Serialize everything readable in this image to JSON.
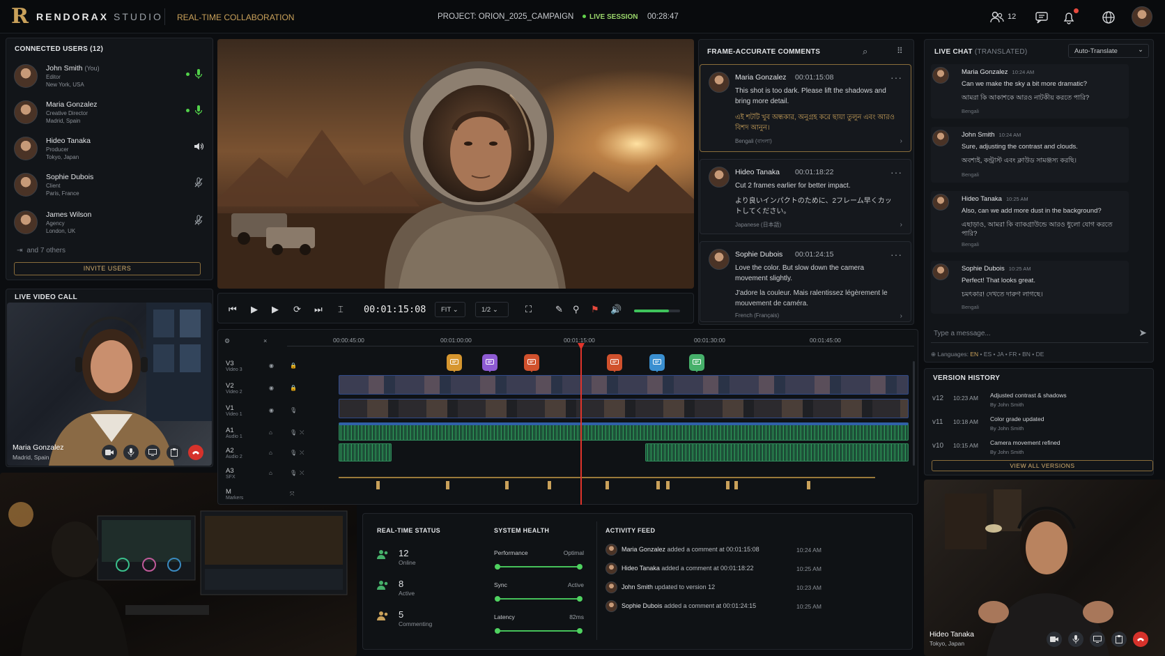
{
  "app": {
    "brand_name": "RENDORAX",
    "brand_sub": "STUDIO",
    "module_title": "REAL-TIME COLLABORATION",
    "project": "PROJECT: ORION_2025_CAMPAIGN",
    "live_label": "LIVE SESSION",
    "session_timer": "00:28:47",
    "user_count": "12"
  },
  "colors": {
    "accent_gold": "#c9a15a",
    "live_green": "#63d44c",
    "danger_red": "#d6322b",
    "audio_green": "#2f9b5a",
    "video_blue": "#2f4a8a"
  },
  "users": {
    "header": "CONNECTED USERS (12)",
    "list": [
      {
        "name": "John Smith",
        "you": "(You)",
        "role": "Editor",
        "location": "New York, USA",
        "status": "mic-on"
      },
      {
        "name": "Maria Gonzalez",
        "role": "Creative Director",
        "location": "Madrid, Spain",
        "status": "mic-on"
      },
      {
        "name": "Hideo Tanaka",
        "role": "Producer",
        "location": "Tokyo, Japan",
        "status": "speaker"
      },
      {
        "name": "Sophie Dubois",
        "role": "Client",
        "location": "Paris, France",
        "status": "muted"
      },
      {
        "name": "James Wilson",
        "role": "Agency",
        "location": "London, UK",
        "status": "muted"
      }
    ],
    "others": "and 7 others",
    "invite_label": "INVITE USERS"
  },
  "video_call": {
    "header": "LIVE VIDEO CALL",
    "caller_name": "Maria Gonzalez",
    "caller_location": "Madrid, Spain"
  },
  "second_call": {
    "name": "Hideo Tanaka",
    "location": "Tokyo, Japan"
  },
  "player": {
    "timecode": "00:01:15:08",
    "fit_label": "FIT",
    "res_label": "1/2",
    "volume": 0.75
  },
  "comments": {
    "header": "FRAME-ACCURATE COMMENTS",
    "items": [
      {
        "name": "Maria Gonzalez",
        "time": "00:01:15:08",
        "text": "This shot is too dark. Please lift the shadows and bring more detail.",
        "translation": "এই শটটি খুব অন্ধকার, অনুগ্রহ করে ছায়া তুলুন এবং আরও বিশদ আনুন।",
        "lang": "Bengali (বাংলা)"
      },
      {
        "name": "Hideo Tanaka",
        "time": "00:01:18:22",
        "text": "Cut 2 frames earlier for better impact.",
        "translation": "より良いインパクトのために、2フレーム早くカットしてください。",
        "lang": "Japanese (日本語)"
      },
      {
        "name": "Sophie Dubois",
        "time": "00:01:24:15",
        "text": "Love the color. But slow down the camera movement slightly.",
        "translation": "J'adore la couleur. Mais ralentissez légèrement le mouvement de caméra.",
        "lang": "French (Français)"
      }
    ]
  },
  "chat": {
    "header": "LIVE CHAT",
    "header_sub": "(TRANSLATED)",
    "translate_option": "Auto-Translate",
    "messages": [
      {
        "name": "Maria Gonzalez",
        "time": "10:24 AM",
        "text": "Can we make the sky a bit more dramatic?",
        "translation": "আমরা কি আকাশকে আরও নাটকীয় করতে পারি?",
        "lang": "Bengali"
      },
      {
        "name": "John Smith",
        "time": "10:24 AM",
        "text": "Sure, adjusting the contrast and clouds.",
        "translation": "অবশ্যই, কন্ট্রাস্ট এবং ক্লাউড সামঞ্জস্য করছি।",
        "lang": "Bengali"
      },
      {
        "name": "Hideo Tanaka",
        "time": "10:25 AM",
        "text": "Also, can we add more dust in the background?",
        "translation": "এছাড়াও, আমরা কি ব্যাকগ্রাউন্ডে আরও ধুলো যোগ করতে পারি?",
        "lang": "Bengali"
      },
      {
        "name": "Sophie Dubois",
        "time": "10:25 AM",
        "text": "Perfect! That looks great.",
        "translation": "চমৎকার! দেখতে দারুণ লাগছে।",
        "lang": "Bengali"
      }
    ],
    "input_placeholder": "Type a message...",
    "languages_label": "Languages:",
    "languages": [
      "EN",
      "ES",
      "JA",
      "FR",
      "BN",
      "DE"
    ]
  },
  "versions": {
    "header": "VERSION HISTORY",
    "items": [
      {
        "v": "v12",
        "time": "10:23 AM",
        "desc": "Adjusted contrast & shadows",
        "by": "By John Smith"
      },
      {
        "v": "v11",
        "time": "10:18 AM",
        "desc": "Color grade updated",
        "by": "By John Smith"
      },
      {
        "v": "v10",
        "time": "10:15 AM",
        "desc": "Camera movement refined",
        "by": "By John Smith"
      }
    ],
    "view_all": "VIEW ALL VERSIONS"
  },
  "timeline": {
    "ruler": [
      "00:00:45:00",
      "00:01:00:00",
      "00:01:15:00",
      "00:01:30:00",
      "00:01:45:00"
    ],
    "tracks": [
      {
        "id": "V3",
        "name": "Video 3"
      },
      {
        "id": "V2",
        "name": "Video 2"
      },
      {
        "id": "V1",
        "name": "Video 1"
      },
      {
        "id": "A1",
        "name": "Audio 1"
      },
      {
        "id": "A2",
        "name": "Audio 2"
      },
      {
        "id": "A3",
        "name": "SFX"
      },
      {
        "id": "M",
        "name": "Markers"
      }
    ]
  },
  "status": {
    "rt_header": "REAL-TIME STATUS",
    "rt": [
      {
        "num": "12",
        "label": "Online"
      },
      {
        "num": "8",
        "label": "Active"
      },
      {
        "num": "5",
        "label": "Commenting"
      }
    ],
    "sh_header": "SYSTEM HEALTH",
    "sh": [
      {
        "label": "Performance",
        "value": "Optimal"
      },
      {
        "label": "Sync",
        "value": "Active"
      },
      {
        "label": "Latency",
        "value": "82ms"
      }
    ],
    "feed_header": "ACTIVITY FEED",
    "feed": [
      {
        "name": "Maria Gonzalez",
        "action": "added a comment at 00:01:15:08",
        "time": "10:24 AM"
      },
      {
        "name": "Hideo Tanaka",
        "action": "added a comment at 00:01:18:22",
        "time": "10:25 AM"
      },
      {
        "name": "John Smith",
        "action": "updated to version 12",
        "time": "10:23 AM"
      },
      {
        "name": "Sophie Dubois",
        "action": "added a comment at 00:01:24:15",
        "time": "10:25 AM"
      }
    ]
  }
}
